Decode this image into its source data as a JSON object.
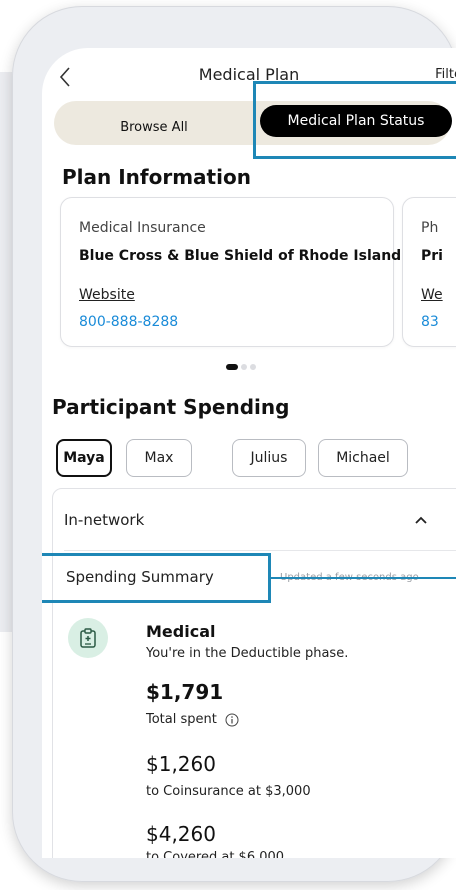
{
  "header": {
    "title": "Medical Plan",
    "filter_label": "Filte"
  },
  "segment": {
    "browse_label": "Browse All",
    "status_label": "Medical Plan Status"
  },
  "plan_info": {
    "title": "Plan Information",
    "cards": [
      {
        "type": "Medical Insurance",
        "name": "Blue Cross & Blue Shield of Rhode Island",
        "website": "Website",
        "phone": "800-888-8288"
      },
      {
        "type": "Ph",
        "name": "Pri",
        "website": "We",
        "phone": "83"
      }
    ],
    "pager": {
      "count": 3,
      "active": 0
    }
  },
  "participants": {
    "title": "Participant Spending",
    "people": [
      "Maya",
      "Max",
      "Julius",
      "Michael"
    ],
    "selected": "Maya"
  },
  "spending": {
    "network_label": "In-network",
    "summary_label": "Spending Summary",
    "updated": "Updated a few seconds ago",
    "medical": {
      "title": "Medical",
      "phase": "You're in the Deductible phase.",
      "total": "$1,791",
      "total_label": "Total spent",
      "coinsurance_amount": "$1,260",
      "coinsurance_label": "to Coinsurance at $3,000",
      "covered_amount": "$4,260",
      "covered_label": "to Covered at $6,000"
    }
  },
  "colors": {
    "highlight": "#1e87b6",
    "link": "#1a8bd8",
    "medical_icon_bg": "#d9efe4"
  }
}
